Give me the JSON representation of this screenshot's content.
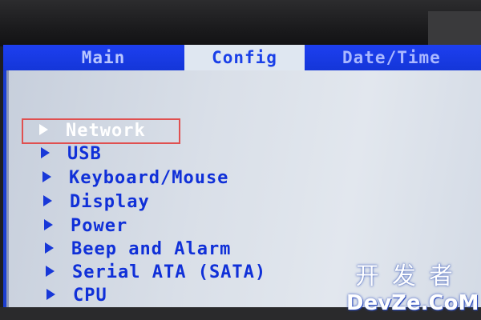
{
  "tabs": [
    {
      "label": "Main"
    },
    {
      "label": "Config",
      "active": true
    },
    {
      "label": "Date/Time"
    }
  ],
  "menu_items": [
    {
      "label": "Network",
      "selected": true
    },
    {
      "label": "USB"
    },
    {
      "label": "Keyboard/Mouse"
    },
    {
      "label": "Display"
    },
    {
      "label": "Power"
    },
    {
      "label": "Beep and Alarm"
    },
    {
      "label": "Serial ATA (SATA)"
    },
    {
      "label": "CPU"
    }
  ],
  "watermark": {
    "chinese": "开发者",
    "english": "DevZe.CoM"
  },
  "colors": {
    "bios_blue": "#1c3ed0",
    "active_tab": "#dfe7f1",
    "menu_text": "#1030d8",
    "selected_text": "#ffffff",
    "highlight_border": "#e05050"
  }
}
